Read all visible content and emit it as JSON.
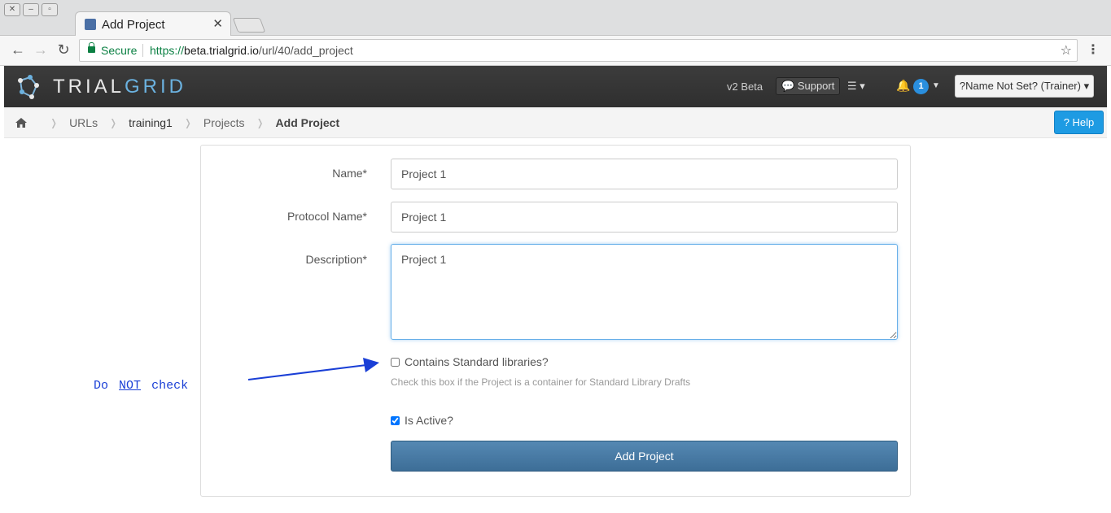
{
  "browser": {
    "tab_title": "Add Project",
    "secure_label": "Secure",
    "url_scheme": "https://",
    "url_host": "beta.trialgrid.io",
    "url_path": "/url/40/add_project"
  },
  "navbar": {
    "brand_part1": "TRIAL",
    "brand_part2": "GRID",
    "version": "v2 Beta",
    "support_label": "Support",
    "notification_count": "1",
    "user_menu": "?Name Not Set? (Trainer)"
  },
  "breadcrumb": {
    "items": [
      "URLs",
      "training1",
      "Projects",
      "Add Project"
    ],
    "help_label": "Help"
  },
  "form": {
    "name_label": "Name*",
    "name_value": "Project 1",
    "protocol_label": "Protocol Name*",
    "protocol_value": "Project 1",
    "description_label": "Description*",
    "description_value": "Project 1",
    "standard_libraries_label": "Contains Standard libraries?",
    "standard_libraries_checked": false,
    "standard_libraries_help": "Check this box if the Project is a container for Standard Library Drafts",
    "is_active_label": "Is Active?",
    "is_active_checked": true,
    "submit_label": "Add Project"
  },
  "annotation": {
    "text_part1": "Do",
    "text_part2": "NOT",
    "text_part3": "check",
    "color": "#1a3fd6"
  }
}
